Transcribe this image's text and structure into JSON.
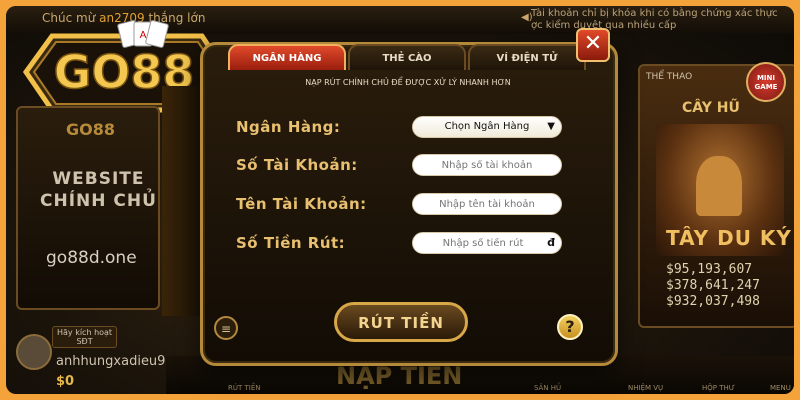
{
  "background": {
    "ticker_prefix": "Chúc mừ",
    "ticker_user": "an2709",
    "ticker_suffix": "thắng lớn",
    "notice_line1": "Tài khoản chỉ bị khóa khi có bằng chứng xác thực",
    "notice_line2": "ợc kiểm duyệt qua nhiều cấp",
    "logo_text": "GO88",
    "left_card_brand": "GO88",
    "left_card_line1": "WEBSITE",
    "left_card_line2": "CHÍNH CHỦ",
    "left_card_domain": "go88d.one",
    "vip_line1": "Hãy kích hoạt",
    "vip_line2": "SĐT",
    "username": "anhhungxadieu9",
    "balance": "$0",
    "right_card_sport": "THỂ THAO",
    "mini_game": "MINI GAME",
    "right_card_title": "CÂY HŨ",
    "right_card_brand": "TÂY DU KÝ",
    "jackpots": [
      "$95,193,607",
      "$378,641,247",
      "$932,037,498"
    ],
    "bottom_center": "NẠP TIỀN",
    "bottom_items": [
      "RÚT TIỀN",
      "SẢN HỦ",
      "NHIỆM VỤ",
      "HỘP THƯ",
      "MENU"
    ]
  },
  "modal": {
    "tabs": [
      {
        "label": "NGÂN HÀNG",
        "active": true
      },
      {
        "label": "THẺ CÀO",
        "active": false
      },
      {
        "label": "VÍ ĐIỆN TỬ",
        "active": false
      }
    ],
    "close_icon": "✕",
    "subtitle": "NẠP RÚT CHÍNH CHỦ ĐỂ ĐƯỢC XỬ LÝ NHANH HƠN",
    "fields": [
      {
        "label": "Ngân Hàng:",
        "type": "select",
        "value": "Chọn Ngân Hàng"
      },
      {
        "label": "Số Tài Khoản:",
        "type": "input",
        "placeholder": "Nhập số tài khoản"
      },
      {
        "label": "Tên Tài Khoản:",
        "type": "input",
        "placeholder": "Nhập tên tài khoản"
      },
      {
        "label": "Số Tiền Rút:",
        "type": "input",
        "placeholder": "Nhập số tiền rút",
        "suffix": "đ"
      }
    ],
    "submit_label": "RÚT TIỀN",
    "help_icon": "?",
    "history_icon": "≡"
  },
  "colors": {
    "accent_gold": "#e8c070",
    "tab_active": "#e04a2a",
    "frame_border": "#f4a23a"
  }
}
